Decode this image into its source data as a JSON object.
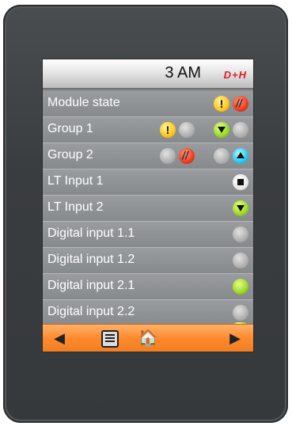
{
  "header": {
    "time": "3 AM",
    "logo": "D+H"
  },
  "rows": [
    {
      "label": "Module state"
    },
    {
      "label": "Group 1"
    },
    {
      "label": "Group 2"
    },
    {
      "label": "LT Input 1"
    },
    {
      "label": "LT Input 2"
    },
    {
      "label": "Digital input 1.1"
    },
    {
      "label": "Digital input 1.2"
    },
    {
      "label": "Digital input 2.1"
    },
    {
      "label": "Digital input 2.2"
    }
  ],
  "icons": {
    "warning_glyph": "!",
    "back_glyph": "◀",
    "forward_glyph": "▶",
    "home_glyph": "🏠"
  },
  "colors": {
    "accent_orange": "#ff8a2e",
    "brand_red": "#e21b2c",
    "status_green": "#9ad824",
    "status_yellow": "#ffc61a",
    "status_red": "#ef3b1e",
    "status_cyan": "#28c7ee"
  }
}
